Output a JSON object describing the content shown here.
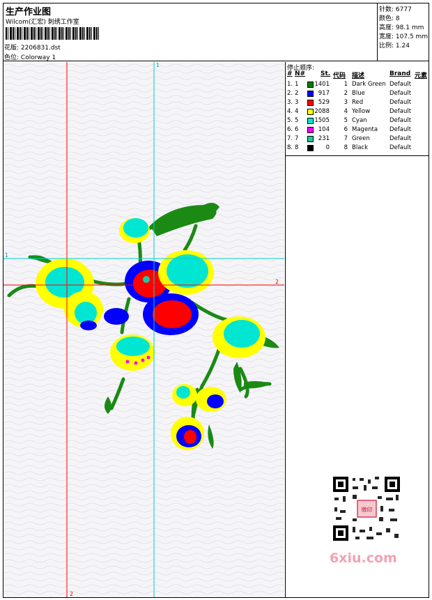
{
  "header": {
    "title": "生产作业图",
    "subtitle": "Wilcom(汇宏) 刺绣工作室",
    "design_label": "花版:",
    "design_value": "2206831.dst",
    "colorway_label": "色位:",
    "colorway_value": "Colorway 1"
  },
  "stats": {
    "stitches_label": "针数:",
    "stitches_value": "6777",
    "colors_label": "颜色:",
    "colors_value": "8",
    "height_label": "高度:",
    "height_value": "98.1 mm",
    "width_label": "宽度:",
    "width_value": "107.5 mm",
    "scale_label": "比例:",
    "scale_value": "1.24"
  },
  "stop_sequence": {
    "title": "停止顺序:",
    "columns": [
      "#",
      "N#",
      "St.",
      "代码",
      "描述",
      "Brand",
      "元素"
    ],
    "rows": [
      {
        "idx": "1.",
        "n": "1",
        "color": "#008000",
        "st": "1401",
        "code": "1",
        "desc": "Dark Green",
        "brand": "Default"
      },
      {
        "idx": "2.",
        "n": "2",
        "color": "#0000ff",
        "st": "917",
        "code": "2",
        "desc": "Blue",
        "brand": "Default"
      },
      {
        "idx": "3.",
        "n": "3",
        "color": "#ff0000",
        "st": "529",
        "code": "3",
        "desc": "Red",
        "brand": "Default"
      },
      {
        "idx": "4.",
        "n": "4",
        "color": "#ffff00",
        "st": "2088",
        "code": "4",
        "desc": "Yellow",
        "brand": "Default"
      },
      {
        "idx": "5.",
        "n": "5",
        "color": "#00e6d2",
        "st": "1505",
        "code": "5",
        "desc": "Cyan",
        "brand": "Default"
      },
      {
        "idx": "6.",
        "n": "6",
        "color": "#ff00ff",
        "st": "104",
        "code": "6",
        "desc": "Magenta",
        "brand": "Default"
      },
      {
        "idx": "7.",
        "n": "7",
        "color": "#1ec8a0",
        "st": "231",
        "code": "7",
        "desc": "Green",
        "brand": "Default"
      },
      {
        "idx": "8.",
        "n": "8",
        "color": "#000000",
        "st": "0",
        "code": "8",
        "desc": "Black",
        "brand": "Default"
      }
    ]
  },
  "guides": {
    "v1": "1",
    "v2": "2",
    "h1": "1",
    "h2": "2"
  },
  "watermark": "6xiu.com",
  "qr_stamp_text": "微印"
}
